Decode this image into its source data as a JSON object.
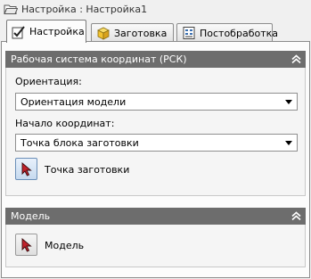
{
  "window": {
    "title": "Настройка : Настройка1"
  },
  "tabs": [
    {
      "label": "Настройка",
      "icon": "settings-check-icon",
      "active": true
    },
    {
      "label": "Заготовка",
      "icon": "stock-cube-icon",
      "active": false
    },
    {
      "label": "Постобработка",
      "icon": "postprocessor-icon",
      "active": false
    }
  ],
  "wcs_panel": {
    "title": "Рабочая система координат (РСК)",
    "orientation_label": "Ориентация:",
    "orientation_value": "Ориентация модели",
    "origin_label": "Начало координат:",
    "origin_value": "Точка блока заготовки",
    "point_button_label": "Точка заготовки"
  },
  "model_panel": {
    "title": "Модель",
    "model_button_label": "Модель"
  },
  "colors": {
    "panel_header": "#6d6d6d",
    "cursor_red": "#c0212b",
    "cube_yellow": "#f2c230"
  }
}
